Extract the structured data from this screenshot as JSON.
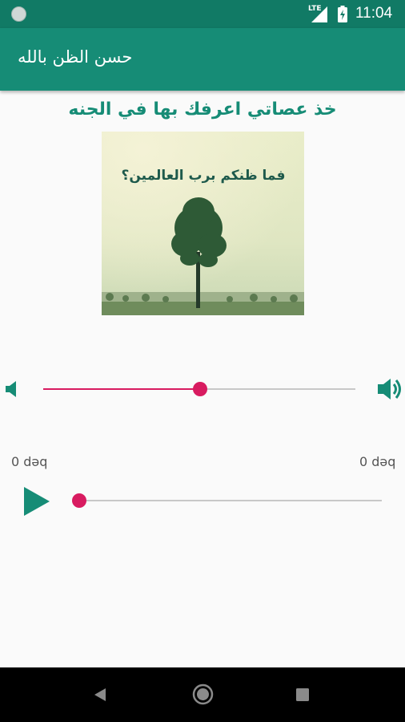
{
  "status_bar": {
    "network_label": "LTE",
    "time": "11:04"
  },
  "app_bar": {
    "title": "حسن الظن بالله"
  },
  "content": {
    "headline": "خذ عصاتي اعرفك بها في الجنه",
    "cover_caption": "فما ظنكم برب العالمين؟"
  },
  "volume": {
    "level": 0.502
  },
  "player": {
    "elapsed": "0 dəq",
    "duration": "0 dəq",
    "progress": 0.0
  },
  "colors": {
    "primary": "#168c76",
    "primary_dark": "#117a65",
    "accent": "#d81b60"
  },
  "icons": {
    "volume_low": "volume-low-icon",
    "volume_high": "volume-high-icon",
    "play": "play-icon",
    "back": "nav-back-icon",
    "home": "nav-home-icon",
    "recent": "nav-recent-icon"
  }
}
